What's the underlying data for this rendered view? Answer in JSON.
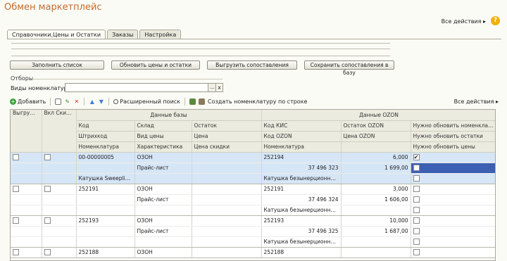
{
  "window": {
    "title": "Обмен маркетплейс",
    "all_actions": "Все действия ▸",
    "help": "?"
  },
  "tabs": [
    "Справочники,Цены и Остатки",
    "Заказы",
    "Настройка"
  ],
  "buttons": {
    "fill_list": "Заполнить список",
    "update_prices": "Обновить цены и остатки",
    "unload_mappings": "Выгрузить сопоставления",
    "save_mappings": "Сохранить сопоставления в базу"
  },
  "filters": {
    "label": "Отборы",
    "nomenclature_kinds_label": "Виды номенклатуры:",
    "nomenclature_kinds_value": "",
    "pick": "...",
    "clear": "x"
  },
  "toolbar": {
    "add": "Добавить",
    "advanced_search": "Расширенный поиск",
    "create_by_row": "Создать номенклатуру по строке",
    "all_actions": "Все действия ▸"
  },
  "grid": {
    "col_export": "Выгружать",
    "col_discounts": "Вкл Скидки",
    "group_db": "Данные базы",
    "group_ozon": "Данные OZON",
    "header_rows": [
      [
        "Код",
        "Склад",
        "Остаток",
        "Код КИС",
        "Остаток OZON",
        "Нужно обновить номенклатуру"
      ],
      [
        "Штрихкод",
        "Вид цены",
        "Цена",
        "Код OZON",
        "Цена OZON",
        "Нужно обновить остатки"
      ],
      [
        "Номенклатура",
        "Характеристика",
        "Цена скидки",
        "Номенклатура",
        "",
        "Нужно обновить цены"
      ]
    ],
    "records": [
      {
        "rows": [
          [
            "00-00000005",
            "ОЗОН",
            "",
            "252194",
            "6,000"
          ],
          [
            "",
            "Прайс-лист",
            "",
            "37 496 323",
            "1 699,00"
          ],
          [
            "Катушка Sweepline E...",
            "",
            "",
            "Катушка безынерционная S...",
            ""
          ]
        ],
        "checks": [
          "✔",
          "",
          ""
        ]
      },
      {
        "rows": [
          [
            "252191",
            "ОЗОН",
            "",
            "252191",
            "3,000"
          ],
          [
            "",
            "Прайс-лист",
            "",
            "37 496 324",
            "1 606,00"
          ],
          [
            "",
            "",
            "",
            "Катушка безынерционная S...",
            ""
          ]
        ],
        "checks": [
          "",
          "",
          ""
        ]
      },
      {
        "rows": [
          [
            "252193",
            "ОЗОН",
            "",
            "252193",
            "10,000"
          ],
          [
            "",
            "Прайс-лист",
            "",
            "37 496 325",
            "1 687,00"
          ],
          [
            "",
            "",
            "",
            "Катушка безынерционная S...",
            ""
          ]
        ],
        "checks": [
          "",
          "",
          ""
        ]
      },
      {
        "rows": [
          [
            "252188",
            "ОЗОН",
            "",
            "252188",
            ""
          ]
        ],
        "checks": [
          ""
        ]
      }
    ]
  }
}
